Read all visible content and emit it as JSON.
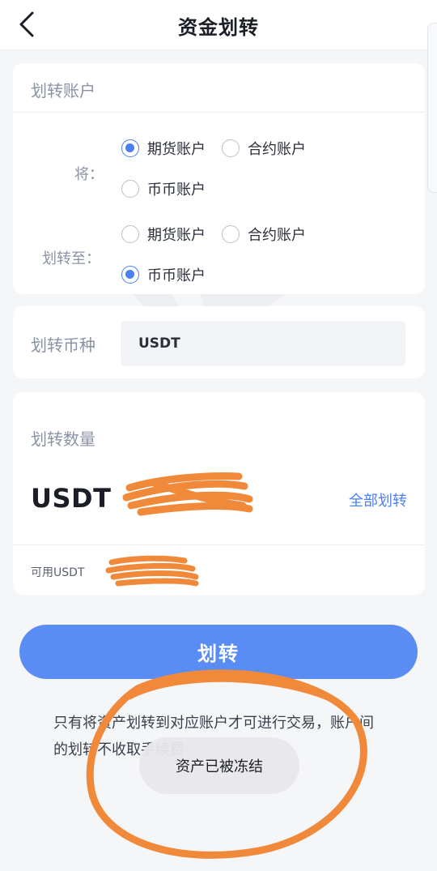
{
  "header": {
    "title": "资金划转",
    "back_icon": "chevron-left-icon"
  },
  "account_section": {
    "title": "划转账户",
    "from_label": "将：",
    "to_label": "划转至：",
    "from_options": [
      {
        "label": "期货账户",
        "checked": true
      },
      {
        "label": "合约账户",
        "checked": false
      },
      {
        "label": "币币账户",
        "checked": false
      }
    ],
    "to_options": [
      {
        "label": "期货账户",
        "checked": false
      },
      {
        "label": "合约账户",
        "checked": false
      },
      {
        "label": "币币账户",
        "checked": true
      }
    ]
  },
  "coin_section": {
    "label": "划转币种",
    "value": "USDT"
  },
  "amount_section": {
    "title": "划转数量",
    "unit": "USDT",
    "all_label": "全部划转",
    "available_label": "可用USDT"
  },
  "actions": {
    "transfer_label": "划转"
  },
  "notice": {
    "text": "只有将资产划转到对应账户才可进行交易，账户间的划转不收取手续费"
  },
  "toast": {
    "text": "资产已被冻结"
  },
  "colors": {
    "accent": "#4a80f0",
    "button": "#5a8df4",
    "scribble": "#f08a3a"
  }
}
